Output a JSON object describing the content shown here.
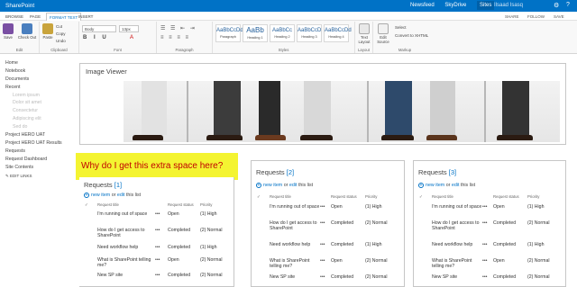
{
  "topbar": {
    "brand": "SharePoint",
    "links": [
      "Newsfeed",
      "SkyDrive",
      "Sites"
    ],
    "user": "Ilsaad Isasq",
    "gear": "⚙",
    "help": "?"
  },
  "tabs": {
    "items": [
      "BROWSE",
      "PAGE",
      "FORMAT TEXT",
      "INSERT"
    ],
    "active": "FORMAT TEXT",
    "right": [
      "SHARE",
      "FOLLOW",
      "SAVE"
    ]
  },
  "ribbon": {
    "edit": {
      "save": "Save",
      "checkout": "Check Out",
      "label": "Edit"
    },
    "clipboard": {
      "paste": "Paste",
      "cut": "Cut",
      "copy": "Copy",
      "undo": "Undo",
      "label": "Clipboard"
    },
    "font": {
      "family": "Body",
      "size": "13px",
      "label": "Font"
    },
    "paragraph": {
      "label": "Paragraph"
    },
    "styles": [
      {
        "sample": "AaBbCcDdI",
        "name": "Paragraph"
      },
      {
        "sample": "AaBb",
        "name": "Heading 1"
      },
      {
        "sample": "AaBbCc",
        "name": "Heading 2"
      },
      {
        "sample": "AaBbCcD",
        "name": "Heading 3"
      },
      {
        "sample": "AaBbCcDd",
        "name": "Heading 4"
      }
    ],
    "styles_label": "Styles",
    "layout": {
      "text_layout": "Text Layout",
      "label": "Layout"
    },
    "markup": {
      "edit_source": "Edit Source",
      "select": "Select",
      "convert": "Convert to XHTML",
      "label": "Markup"
    }
  },
  "leftnav": {
    "items": [
      "Home",
      "Notebook",
      "Documents",
      "Recent"
    ],
    "recent": [
      "Lorem ipsum",
      "Dolor sit amet",
      "Consectetur",
      "Adipiscing elit",
      "Sed do"
    ],
    "items2": [
      "Project HERO UAT",
      "Project HERO UAT Results",
      "Requests",
      "Request Dashboard",
      "Site Contents"
    ],
    "edit_links": "EDIT LINKS"
  },
  "image_viewer": {
    "title": "Image Viewer"
  },
  "highlight": {
    "text": "Why do I get this extra space here?"
  },
  "panels": [
    {
      "title": "Requests",
      "count": "[1]"
    },
    {
      "title": "Requests",
      "count": "[2]"
    },
    {
      "title": "Requests",
      "count": "[3]"
    }
  ],
  "new_item": {
    "new": "new item",
    "or": "or",
    "edit": "edit",
    "suffix": "this list"
  },
  "columns": [
    "Request title",
    "Request status",
    "Priority"
  ],
  "rows": [
    {
      "title": "I'm running out of space",
      "status": "Open",
      "priority": "(1) High"
    },
    {
      "title": "How do I get access to SharePoint",
      "status": "Completed",
      "priority": "(2) Normal"
    },
    {
      "title": "Need workflow help",
      "status": "Completed",
      "priority": "(1) High"
    },
    {
      "title": "What is SharePoint telling me?",
      "status": "Open",
      "priority": "(2) Normal"
    },
    {
      "title": "New SP site",
      "status": "Completed",
      "priority": "(2) Normal"
    }
  ]
}
